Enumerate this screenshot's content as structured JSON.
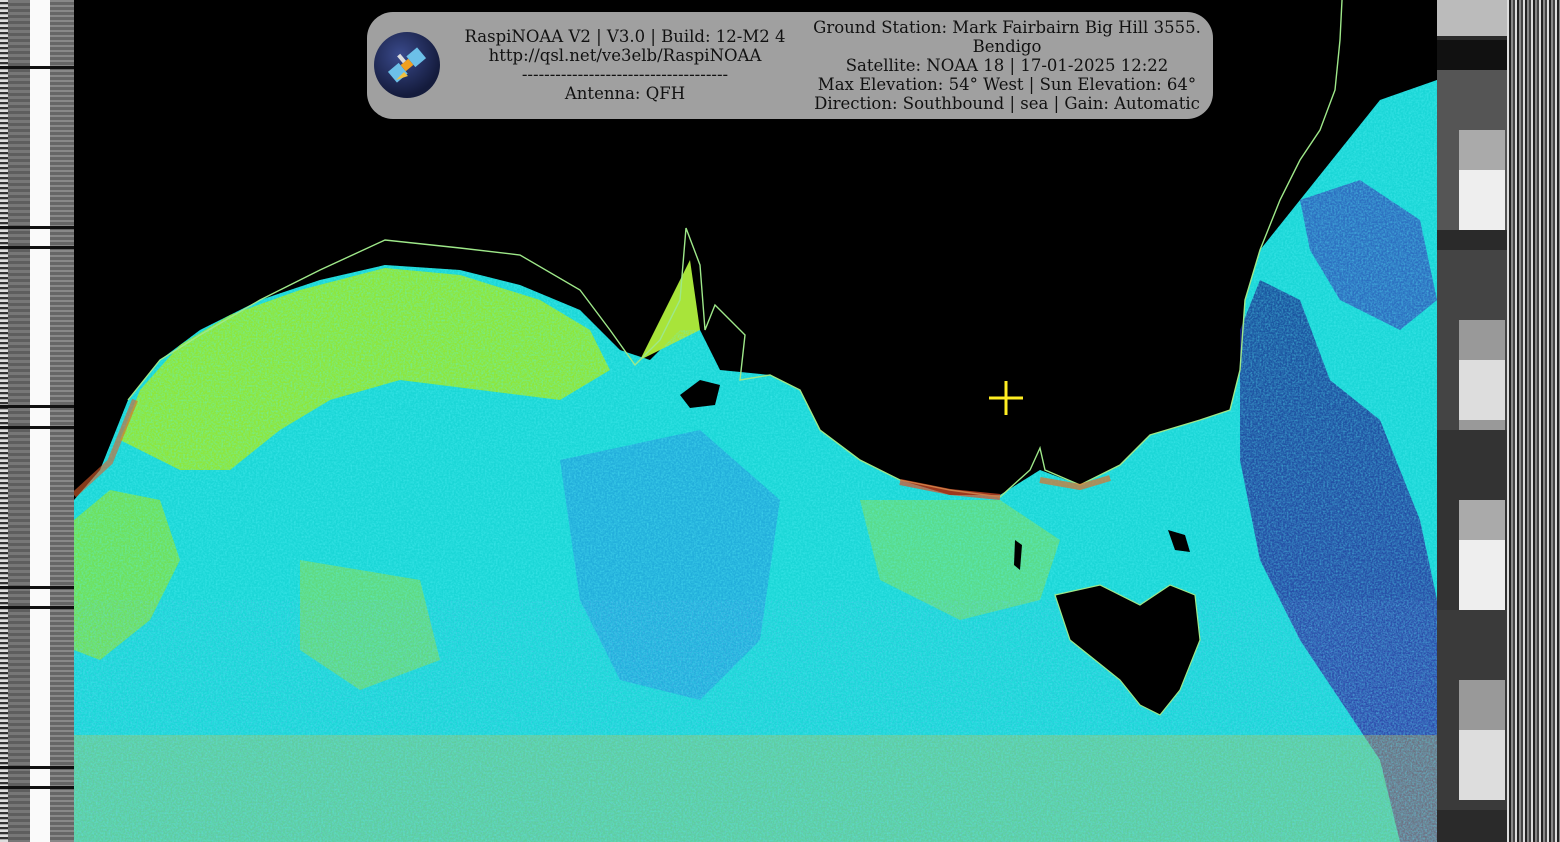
{
  "overlay": {
    "left_lines": [
      "RaspiNOAA V2 | V3.0 | Build: 12-M2 4",
      "http://qsl.net/ve3elb/RaspiNOAA",
      "-------------------------------------",
      "Antenna: QFH"
    ],
    "right_lines": [
      "Ground Station: Mark Fairbairn Big Hill 3555.",
      "Bendigo",
      "Satellite: NOAA 18 | 17-01-2025 12:22",
      "Max Elevation: 54° West | Sun Elevation: 64°",
      "Direction: Southbound | sea | Gain: Automatic"
    ]
  },
  "icons": {
    "logo": "satellite-logo-icon",
    "marker": "crosshair-icon"
  },
  "colors": {
    "panel_bg": "#a0a0a0",
    "crosshair": "#ffee22",
    "coastline": "#9ee889",
    "land_mask": "#000000"
  }
}
